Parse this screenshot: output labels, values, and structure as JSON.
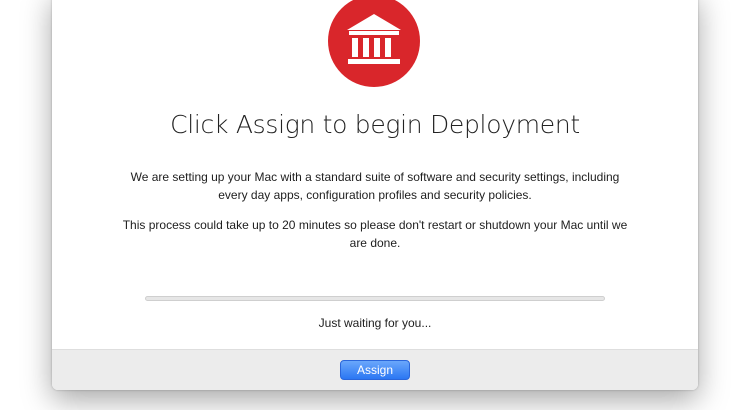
{
  "logo": {
    "icon": "institution-building-icon",
    "color": "#d9262b"
  },
  "heading": "Click Assign to begin Deployment",
  "description": {
    "line1": "We are setting up your Mac with a standard suite of software and security settings, including every day apps, configuration profiles and security policies.",
    "line2": "This process could take up to 20 minutes so please don't restart or shutdown your Mac until we are done."
  },
  "progress": {
    "value": 0
  },
  "status": "Just waiting for you...",
  "footer": {
    "assign_label": "Assign",
    "accent": "#3b86f7"
  }
}
